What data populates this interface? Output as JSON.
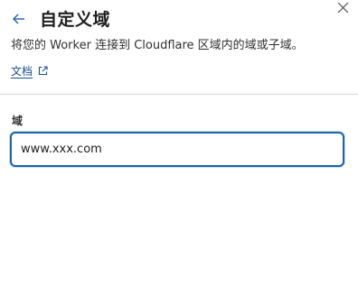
{
  "panel": {
    "title": "自定义域",
    "description": "将您的 Worker 连接到 Cloudflare 区域内的域或子域。",
    "docs_link": {
      "label": "文档",
      "icon": "external-link-icon"
    },
    "back_icon": "arrow-left-icon",
    "close_icon": "close-icon"
  },
  "form": {
    "domain_field": {
      "label": "域",
      "value": "www.xxx.com"
    }
  },
  "colors": {
    "accent": "#1d64a8",
    "link": "#1a4f8a",
    "divider": "#d9d9d9",
    "text": "#1f1f1f"
  }
}
